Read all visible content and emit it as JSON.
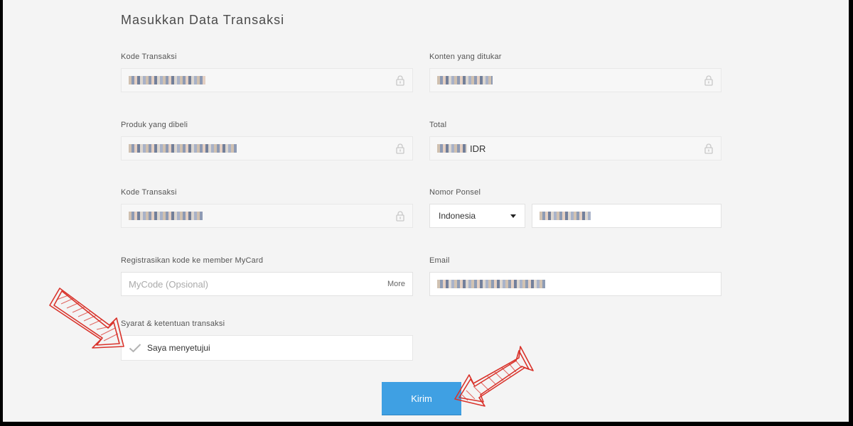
{
  "page": {
    "title": "Masukkan Data Transaksi"
  },
  "fields": {
    "kode_transaksi_1": {
      "label": "Kode Transaksi"
    },
    "konten": {
      "label": "Konten yang ditukar"
    },
    "produk": {
      "label": "Produk yang dibeli"
    },
    "total": {
      "label": "Total",
      "currency": "IDR"
    },
    "kode_transaksi_2": {
      "label": "Kode Transaksi"
    },
    "nomor_ponsel": {
      "label": "Nomor Ponsel",
      "country": "Indonesia"
    },
    "mycode": {
      "label": "Registrasikan kode ke member MyCard",
      "placeholder": "MyCode (Opsional)",
      "more_label": "More"
    },
    "email": {
      "label": "Email"
    },
    "syarat": {
      "label": "Syarat & ketentuan transaksi",
      "agree_label": "Saya menyetujui"
    }
  },
  "actions": {
    "submit_label": "Kirim"
  },
  "colors": {
    "accent": "#3fa0e3",
    "annotation": "#d9332b"
  },
  "icons": {
    "lock": "lock-icon",
    "check": "check-icon",
    "caret": "chevron-down-icon",
    "arrow": "arrow-annotation"
  }
}
